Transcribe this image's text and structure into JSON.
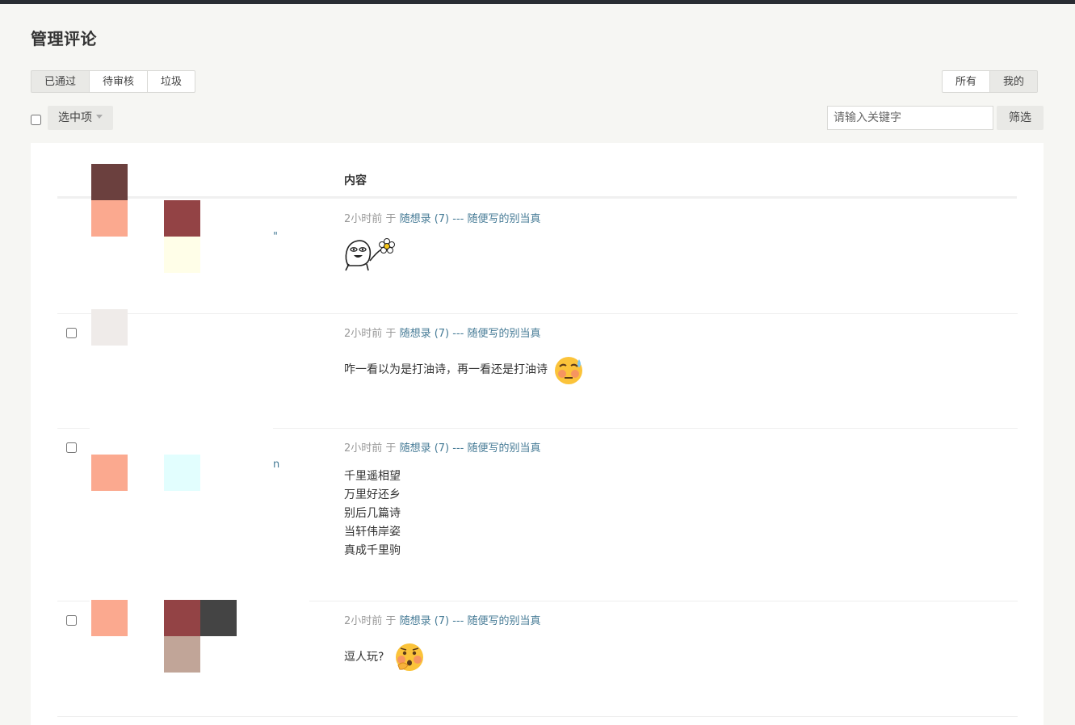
{
  "page": {
    "title": "管理评论"
  },
  "status_tabs": [
    {
      "label": "已通过",
      "active": true
    },
    {
      "label": "待审核",
      "active": false
    },
    {
      "label": "垃圾",
      "active": false
    }
  ],
  "scope_tabs": [
    {
      "label": "所有",
      "active": false
    },
    {
      "label": "我的",
      "active": true
    }
  ],
  "toolbar": {
    "batch_label": "选中项",
    "search_placeholder": "请输入关键字",
    "filter_label": "筛选"
  },
  "table": {
    "content_header": "内容",
    "rows": [
      {
        "time": "2小时前",
        "sep": "于",
        "post": "随想录 (7) --- 随便写的别当真",
        "content_lines": [],
        "emoji": "smiling-face-holding-flower-sticker",
        "ghost": "\""
      },
      {
        "time": "2小时前",
        "sep": "于",
        "post": "随想录 (7) --- 随便写的别当真",
        "content_lines": [
          "咋一看以为是打油诗，再一看还是打油诗"
        ],
        "emoji": "sweating-face-emoji"
      },
      {
        "time": "2小时前",
        "sep": "于",
        "post": "随想录 (7) --- 随便写的别当真",
        "content_lines": [
          "千里遥相望",
          "万里好还乡",
          "别后几篇诗",
          "当轩伟岸姿",
          "真成千里驹"
        ],
        "ghost": "n"
      },
      {
        "time": "2小时前",
        "sep": "于",
        "post": "随想录 (7) --- 随便写的别当真",
        "content_lines": [
          "逗人玩?"
        ],
        "emoji": "hand-over-mouth-blushing-emoji"
      }
    ]
  },
  "colors": {
    "background": "#f6f6f3",
    "panel": "#ffffff",
    "link": "#467b96",
    "muted": "#999999",
    "topbar": "#292d33",
    "avatar_mosaic": [
      "#6b403e",
      "#fba98f",
      "#934345",
      "#fffee8",
      "#efebe9",
      "#e2fefe",
      "#444444",
      "#c1a598"
    ]
  }
}
